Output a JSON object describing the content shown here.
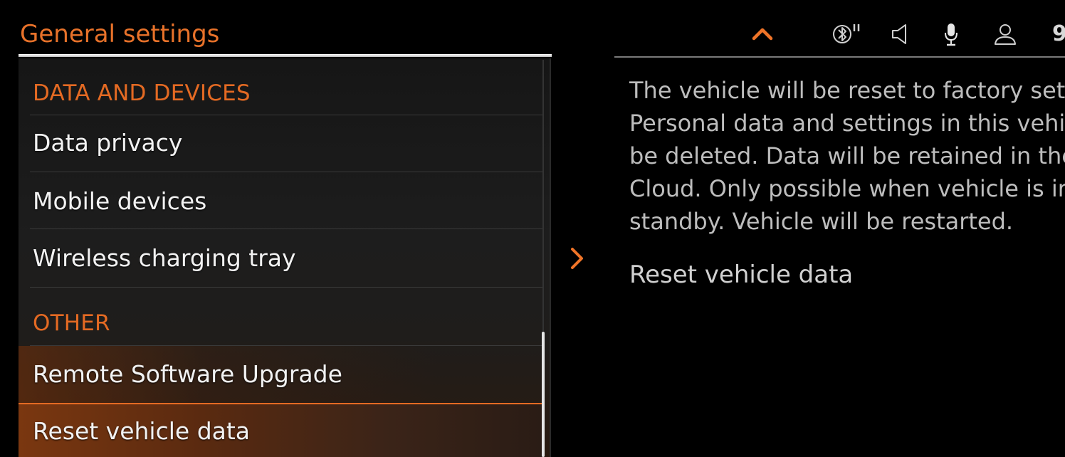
{
  "header": {
    "title": "General settings",
    "time": "9"
  },
  "status_icons": [
    "chevron-up-icon",
    "bluetooth-icon",
    "speaker-icon",
    "microphone-icon",
    "user-profile-icon"
  ],
  "menu": {
    "sections": [
      {
        "label": "DATA AND DEVICES",
        "items": [
          "Data privacy",
          "Mobile devices",
          "Wireless charging tray"
        ]
      },
      {
        "label": "OTHER",
        "items": [
          "Remote Software Upgrade",
          "Reset vehicle data"
        ]
      }
    ],
    "selected_item": "Reset vehicle data"
  },
  "detail": {
    "description_lines": [
      "The vehicle will be reset to factory set",
      "Personal data and settings in this vehi",
      "be deleted. Data will be retained in the",
      "Cloud. Only possible when vehicle is ir",
      "standby. Vehicle will be restarted."
    ],
    "action_label": "Reset vehicle data"
  },
  "colors": {
    "accent": "#e46a23",
    "text": "#f2f2f2",
    "secondary_text": "#bdbdbd",
    "background": "#000000"
  }
}
